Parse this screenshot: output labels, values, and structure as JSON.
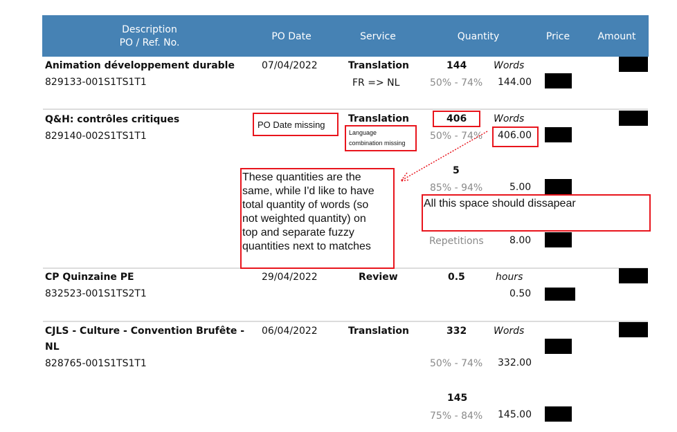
{
  "header": {
    "description_line1": "Description",
    "description_line2": "PO / Ref. No.",
    "po_date": "PO Date",
    "service": "Service",
    "quantity": "Quantity",
    "price": "Price",
    "amount": "Amount"
  },
  "rows": [
    {
      "description": "Animation développement durable",
      "ref": "829133-001S1TS1T1",
      "po_date": "07/04/2022",
      "service": "Translation",
      "language": "FR => NL",
      "quantity": "144",
      "unit": "Words",
      "lines": [
        {
          "label": "50% - 74%",
          "value": "144.00"
        }
      ]
    },
    {
      "description": "Q&H: contrôles critiques",
      "ref": "829140-002S1TS1T1",
      "po_date": "",
      "service": "Translation",
      "quantity": "406",
      "unit": "Words",
      "lines": [
        {
          "label": "50% - 74%",
          "value": "406.00"
        },
        {
          "label": "85% - 94%",
          "value": "5.00",
          "quantity": "5"
        },
        {
          "label": "Repetitions",
          "value": "8.00"
        }
      ]
    },
    {
      "description": "CP Quinzaine PE",
      "ref": "832523-001S1TS2T1",
      "po_date": "29/04/2022",
      "service": "Review",
      "quantity": "0.5",
      "unit": "hours",
      "lines": [
        {
          "label": "",
          "value": "0.50"
        }
      ]
    },
    {
      "description_line1": "CJLS - Culture - Convention Brufête -",
      "description_line2": "NL",
      "ref": "828765-001S1TS1T1",
      "po_date": "06/04/2022",
      "service": "Translation",
      "quantity": "332",
      "unit": "Words",
      "lines": [
        {
          "label": "50% - 74%",
          "value": "332.00"
        },
        {
          "label": "75% - 84%",
          "value": "145.00",
          "quantity": "145"
        }
      ]
    }
  ],
  "annotations": {
    "po_date_missing": "PO Date missing",
    "language_missing_line1": "Language",
    "language_missing_line2": "combination missing",
    "quantities_note": [
      "These quantities are the",
      "same, while I'd like to have",
      "total quantity of words (so",
      "not weighted quantity) on",
      "top and separate fuzzy",
      "quantities next to matches"
    ],
    "space_note": "All this space should dissapear"
  },
  "colors": {
    "header_bg": "#4682b4",
    "annotation_red": "#e8141c",
    "muted_text": "#8a8a8a"
  }
}
